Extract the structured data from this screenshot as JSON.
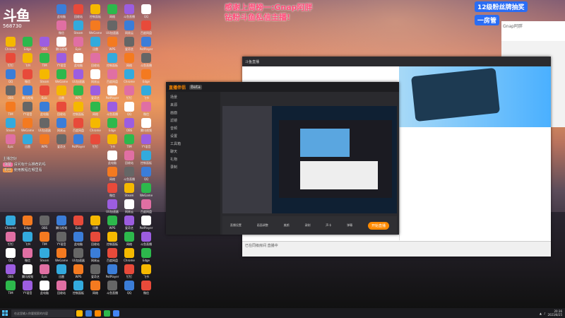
{
  "stream": {
    "logo_text": "斗鱼",
    "room_number": "568730",
    "thanks_line1": "感谢上周榜一:Gnap阿胖",
    "thanks_line2": "钻粉斗鱼私信主播!",
    "banner_1": "12级粉丝牌抽奖",
    "banner_2": "一房管"
  },
  "side_panel": {
    "title": "Gnap阿胖"
  },
  "desktop": {
    "icon_labels": [
      "此电脑",
      "回收站",
      "控制面板",
      "网络",
      "斗鱼直播",
      "QQ",
      "微信",
      "Steam",
      "WeGame",
      "UU加速器",
      "网易云",
      "百度网盘",
      "Chrome",
      "Edge",
      "OBS",
      "腾讯视频",
      "Epic",
      "迅雷",
      "WPS",
      "爱奇艺",
      "PotPlayer",
      "钉钉",
      "飞书",
      "TIM",
      "YY语音"
    ],
    "colors": [
      "#3b7dd8",
      "#e84a3a",
      "#f5b800",
      "#2db84c",
      "#9c5de0",
      "#fff",
      "#e06fa3",
      "#33aadd",
      "#f47a20",
      "#666"
    ]
  },
  "danmu": {
    "line1": "主播您好",
    "line2_tag": "弹幕",
    "line2": "请问有什么推荐的吗",
    "line3_tag": "粉丝",
    "line3": "使用教程在哪里看"
  },
  "browser": {
    "tab_title": "斗鱼直播",
    "footer_text": "已在同级房间 直播中"
  },
  "obs": {
    "title": "直播伴侣",
    "badge": "Beta",
    "side_items": [
      "场景",
      "来源",
      "画面",
      "滤镜",
      "音频",
      "设置",
      "工具箱",
      "聊天",
      "礼物",
      "录制"
    ],
    "toolbar_items": [
      "直播设置",
      "画面调整",
      "美颜",
      "录制",
      "声卡",
      "弹幕"
    ],
    "start_label": "开始直播"
  },
  "taskbar": {
    "search_placeholder": "在这里输入你要搜索的内容",
    "time": "20:36",
    "date": "2023/8/25"
  }
}
